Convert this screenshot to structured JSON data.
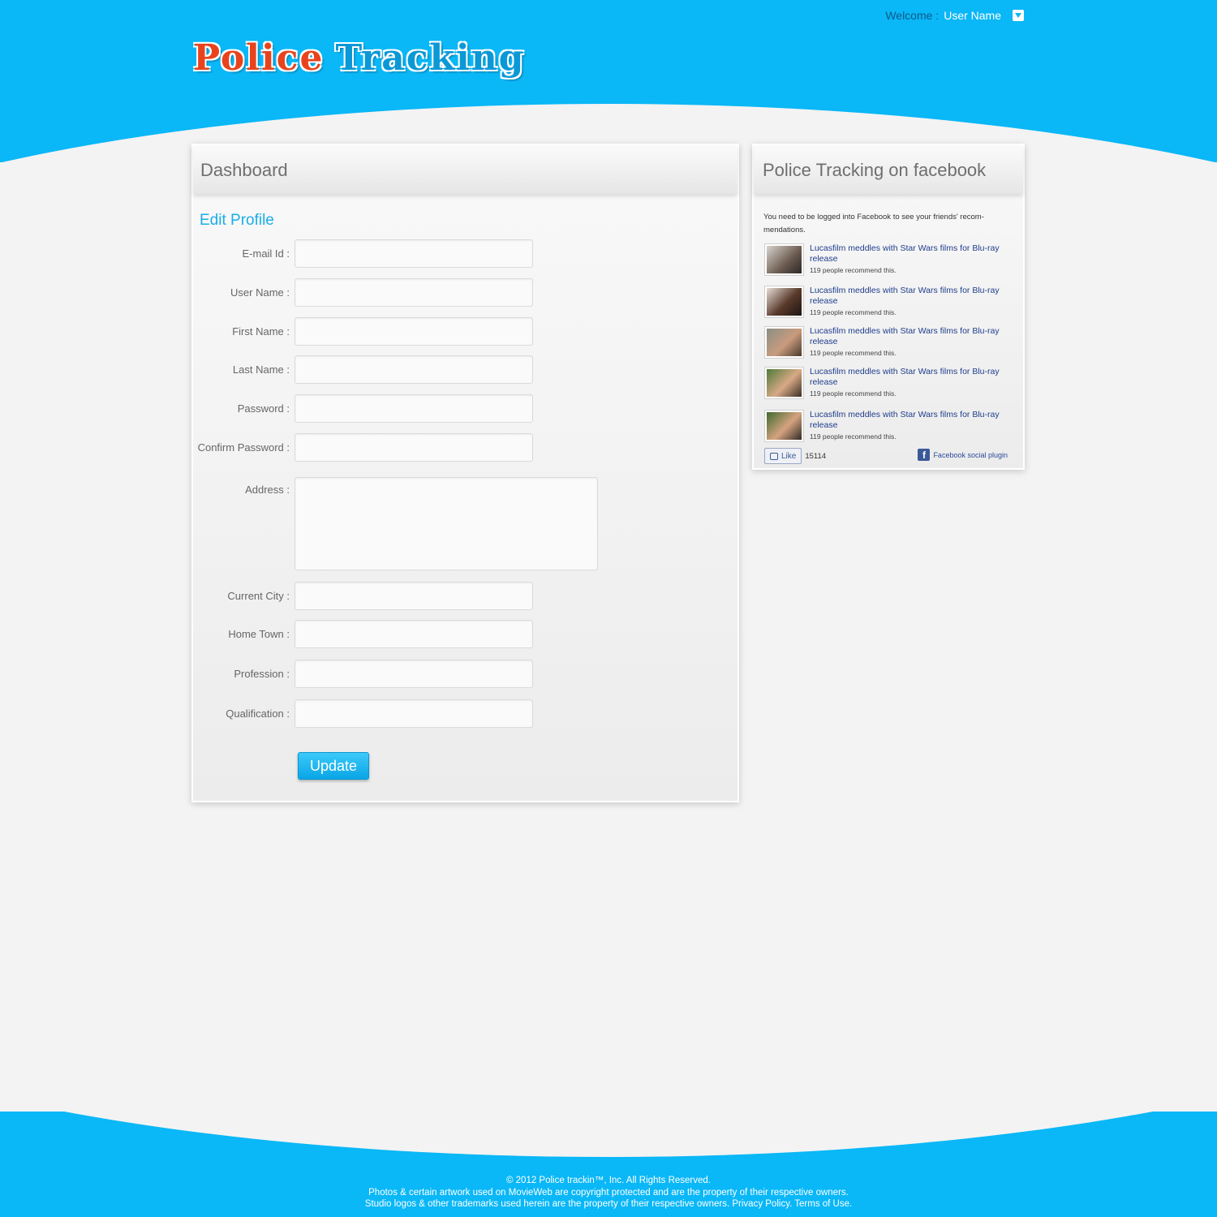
{
  "header": {
    "welcome_label": "Welcome :",
    "user_name": "User Name",
    "logo_word1": "Police",
    "logo_word2": "Tracking"
  },
  "main": {
    "title": "Dashboard",
    "section_title": "Edit Profile",
    "fields": {
      "email": "E-mail Id :",
      "username": "User Name :",
      "first_name": "First Name :",
      "last_name": "Last Name :",
      "password": "Password :",
      "confirm_password": "Confirm Password :",
      "address": "Address :",
      "current_city": "Current City :",
      "home_town": "Home Town :",
      "profession": "Profession :",
      "qualification": "Qualification :"
    },
    "update_label": "Update"
  },
  "sidebar": {
    "title": "Police Tracking on facebook",
    "note": "You need to be logged into Facebook to see your friends' recom-mendations.",
    "items": [
      {
        "link": "Lucasfilm meddles with Star Wars films for Blu-ray release",
        "count": "119 people recommend this."
      },
      {
        "link": "Lucasfilm meddles with Star Wars films for Blu-ray release",
        "count": "119 people recommend this."
      },
      {
        "link": "Lucasfilm meddles with Star Wars films for Blu-ray release",
        "count": "119 people recommend this."
      },
      {
        "link": "Lucasfilm meddles with Star Wars films for Blu-ray release",
        "count": "119 people recommend this."
      },
      {
        "link": "Lucasfilm meddles with Star Wars films for Blu-ray release",
        "count": "119 people recommend this."
      }
    ],
    "like_label": "Like",
    "like_count": "15114",
    "plugin_label": "Facebook social plugin"
  },
  "footer": {
    "line1": "© 2012 Police trackin™, Inc. All Rights Reserved.",
    "line2": "Photos & certain artwork used on MovieWeb are copyright protected and are the property of their respective owners.",
    "line3": "Studio logos & other trademarks used herein are the property of their respective owners. Privacy Policy.  Terms of Use."
  },
  "colors": {
    "brand_blue": "#0ab7f7",
    "logo_red": "#e8431d",
    "section_title": "#19aee8",
    "fb_link": "#1f3d8c"
  }
}
